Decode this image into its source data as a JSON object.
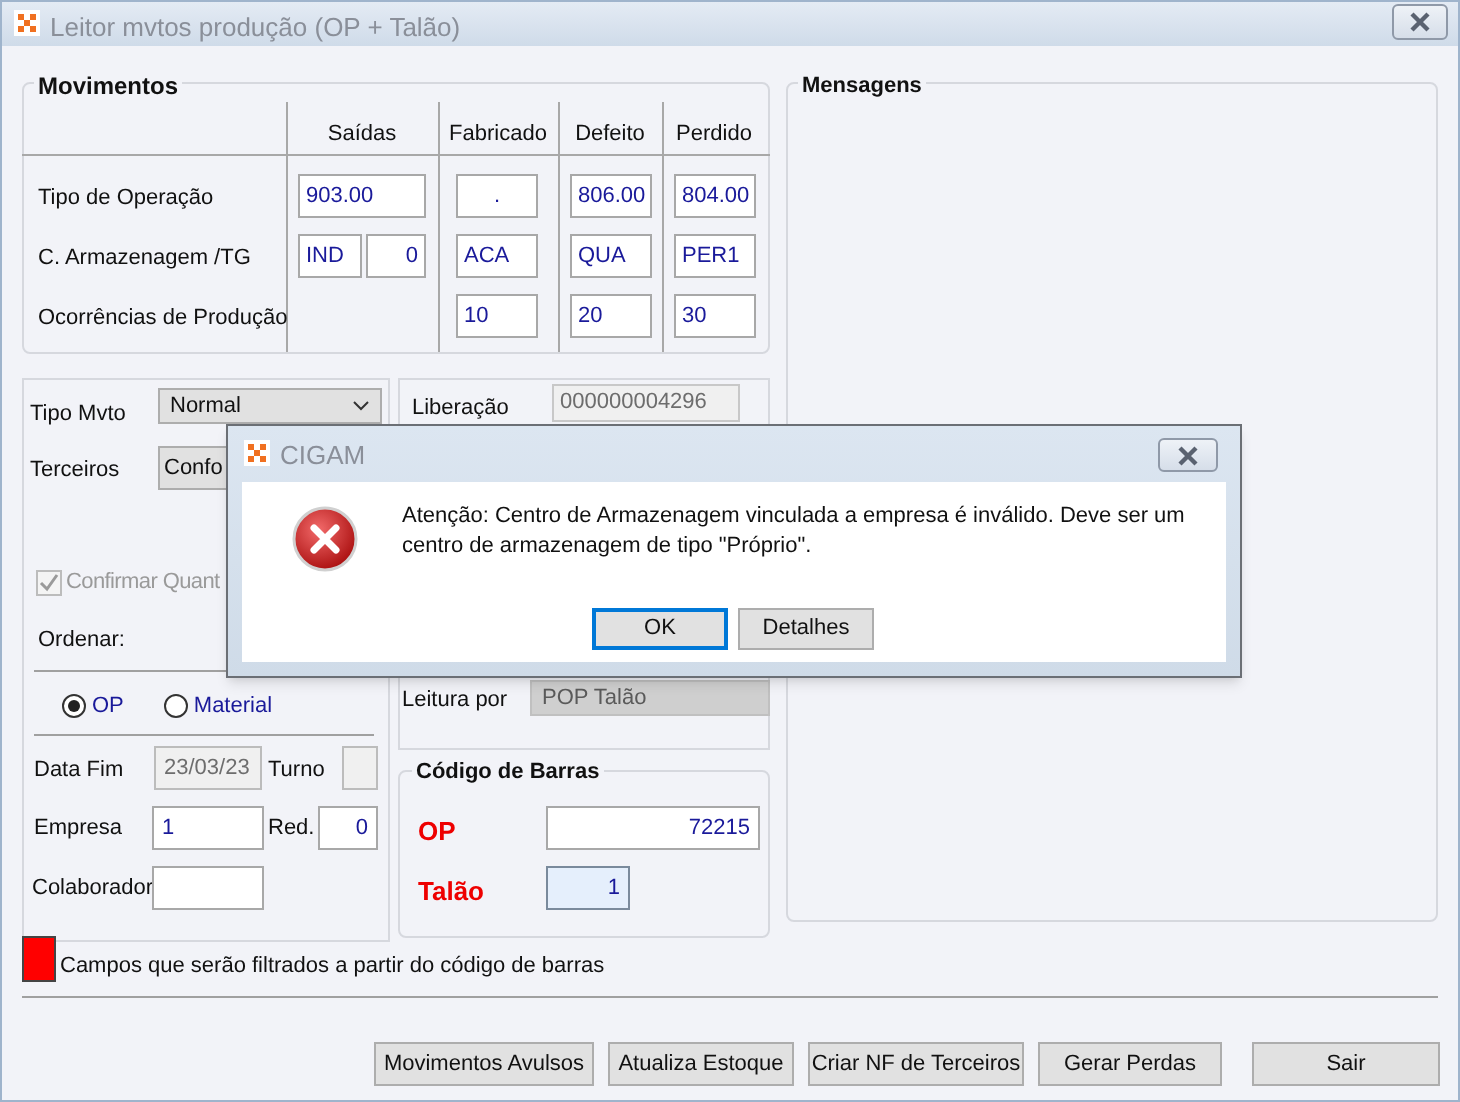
{
  "window": {
    "title": "Leitor mvtos produção (OP + Talão)"
  },
  "movimentos": {
    "title": "Movimentos",
    "columns": [
      "Saídas",
      "Fabricado",
      "Defeito",
      "Perdido"
    ],
    "rows": [
      {
        "label": "Tipo de Operação",
        "saidas": [
          "903.00"
        ],
        "others": [
          ".",
          "806.00",
          "804.00"
        ]
      },
      {
        "label": "C. Armazenagem /TG",
        "saidas": [
          "IND",
          "0"
        ],
        "others": [
          "ACA",
          "QUA",
          "PER1"
        ]
      },
      {
        "label": "Ocorrências de Produção",
        "others": [
          "10",
          "20",
          "30"
        ]
      }
    ]
  },
  "tipo_mvto": {
    "label": "Tipo Mvto",
    "value": "Normal"
  },
  "terceiros": {
    "label": "Terceiros",
    "value": "Confo"
  },
  "liberacao": {
    "label": "Liberação",
    "value": "000000004296"
  },
  "confirmar": {
    "label": "Confirmar Quant",
    "checked": true,
    "disabled": true
  },
  "ordenar": {
    "label": "Ordenar:"
  },
  "leitura": {
    "label": "Leitura por",
    "value": "POP Talão"
  },
  "ordem": [
    {
      "label": "OP",
      "selected": true
    },
    {
      "label": "Material",
      "selected": false
    }
  ],
  "data_fim": {
    "label": "Data Fim",
    "value": "23/03/23",
    "disabled": true
  },
  "turno": {
    "label": "Turno"
  },
  "empresa": {
    "label": "Empresa",
    "value": "1"
  },
  "red": {
    "label": "Red.",
    "value": "0"
  },
  "colaborador": {
    "label": "Colaborador"
  },
  "codigo_barras": {
    "title": "Código de Barras",
    "fields": [
      {
        "label": "OP",
        "value": "72215",
        "focused": false
      },
      {
        "label": "Talão",
        "value": "1",
        "focused": true
      }
    ]
  },
  "mensagens": {
    "title": "Mensagens"
  },
  "legend": {
    "text": "Campos que serão filtrados a partir do código de barras"
  },
  "buttons": [
    "Movimentos Avulsos",
    "Atualiza Estoque",
    "Criar NF de Terceiros",
    "Gerar Perdas",
    "Sair"
  ],
  "dialog": {
    "title": "CIGAM",
    "message": "Atenção: Centro de Armazenagem vinculada a empresa é inválido. Deve ser um centro de armazenagem de tipo \"Próprio\".",
    "buttons": [
      {
        "label": "OK",
        "selected": true
      },
      {
        "label": "Detalhes",
        "selected": false
      }
    ]
  }
}
